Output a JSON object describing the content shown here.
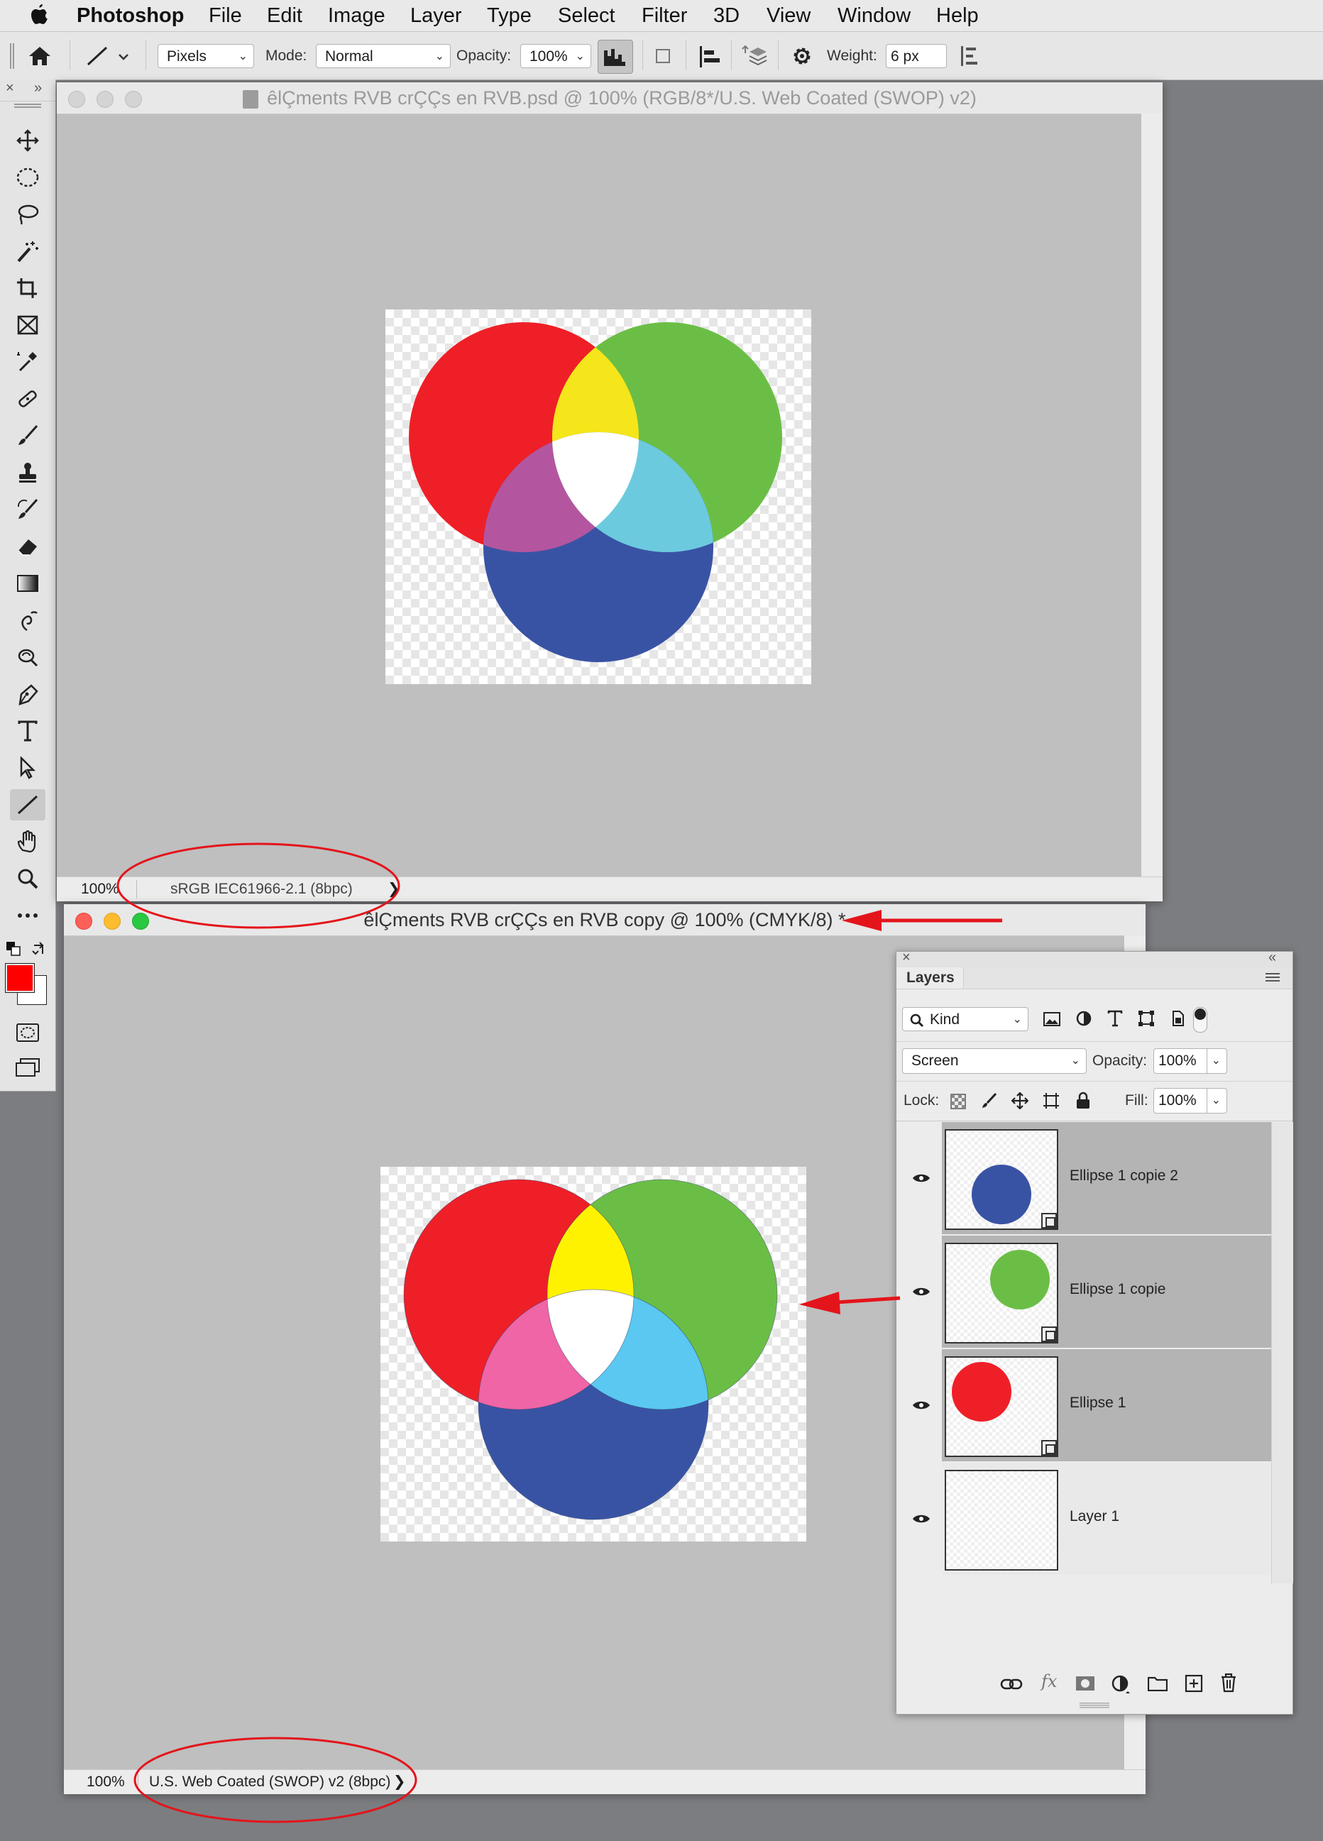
{
  "menubar": {
    "app_name": "Photoshop",
    "items": [
      "File",
      "Edit",
      "Image",
      "Layer",
      "Type",
      "Select",
      "Filter",
      "3D",
      "View",
      "Window",
      "Help"
    ]
  },
  "options_bar": {
    "tool_mode": "Pixels",
    "mode_label": "Mode:",
    "mode_value": "Normal",
    "opacity_label": "Opacity:",
    "opacity_value": "100%",
    "weight_label": "Weight:",
    "weight_value": "6 px"
  },
  "doc1": {
    "title": "êlÇments RVB crÇÇs en RVB.psd @ 100% (RGB/8*/U.S. Web Coated (SWOP) v2)",
    "zoom": "100%",
    "profile": "sRGB IEC61966-2.1 (8bpc)",
    "colors": {
      "red": "#ef1f27",
      "green": "#6bbe45",
      "blue": "#3953a4",
      "yellow": "#f5e51b",
      "magenta": "#b3569f",
      "cyan": "#6ccadf",
      "white": "#ffffff"
    }
  },
  "doc2": {
    "title": "êlÇments RVB crÇÇs en RVB copy @ 100% (CMYK/8) *",
    "zoom": "100%",
    "profile": "U.S. Web Coated (SWOP) v2 (8bpc)",
    "colors": {
      "red": "#ef1f27",
      "green": "#6bbe45",
      "blue": "#3953a4",
      "yellow": "#fff200",
      "magenta": "#ef65a6",
      "cyan": "#5ac8f1",
      "white": "#ffffff"
    }
  },
  "layers_panel": {
    "tab": "Layers",
    "filter_kind": "Kind",
    "blend_mode": "Screen",
    "opacity_label": "Opacity:",
    "opacity_value": "100%",
    "lock_label": "Lock:",
    "fill_label": "Fill:",
    "fill_value": "100%",
    "layers": [
      {
        "name": "Ellipse 1 copie 2",
        "color": "#3953a4",
        "selected": true
      },
      {
        "name": "Ellipse 1 copie",
        "color": "#6bbe45",
        "selected": true
      },
      {
        "name": "Ellipse 1",
        "color": "#ef1f27",
        "selected": true
      },
      {
        "name": "Layer 1",
        "color": "",
        "selected": false
      }
    ]
  },
  "annotations": {
    "color": "#e4141b"
  }
}
